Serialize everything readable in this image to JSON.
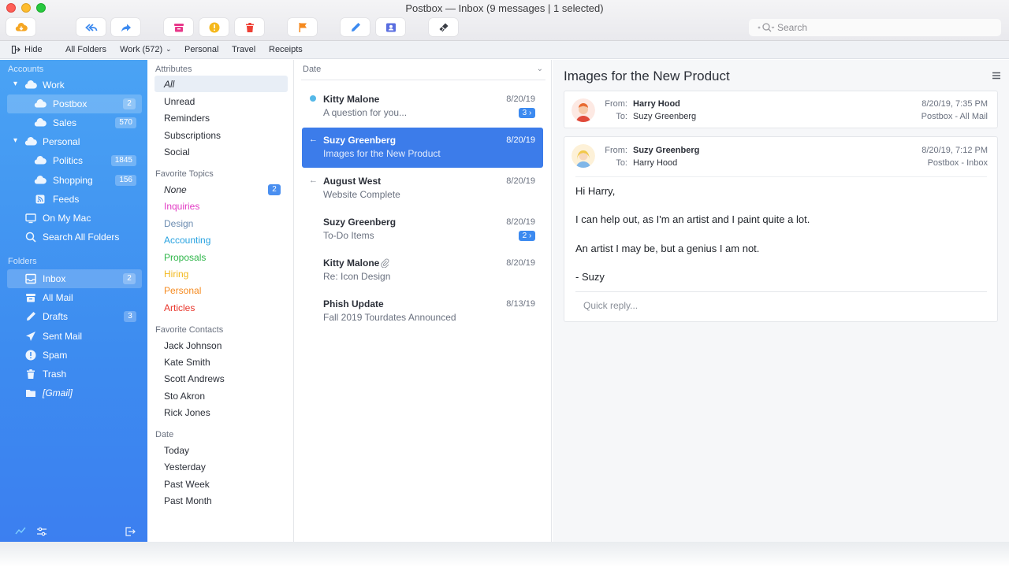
{
  "window": {
    "title": "Postbox — Inbox (9 messages | 1 selected)"
  },
  "toolbar": {
    "buttons": [
      {
        "name": "get-mail-button",
        "icon": "cloud-download-icon"
      },
      {
        "name": "reply-all-button",
        "icon": "reply-all-icon"
      },
      {
        "name": "forward-button",
        "icon": "forward-icon"
      },
      {
        "name": "archive-button",
        "icon": "archive-icon"
      },
      {
        "name": "junk-button",
        "icon": "warning-icon"
      },
      {
        "name": "delete-button",
        "icon": "trash-icon"
      },
      {
        "name": "flag-button",
        "icon": "flag-icon"
      },
      {
        "name": "compose-button",
        "icon": "pencil-icon"
      },
      {
        "name": "contacts-button",
        "icon": "contact-card-icon"
      },
      {
        "name": "customize-button",
        "icon": "brush-icon"
      }
    ],
    "search_placeholder": "Search"
  },
  "tabbar": {
    "hide_label": "Hide",
    "tabs": [
      "All Folders",
      "Work (572)",
      "Personal",
      "Travel",
      "Receipts"
    ]
  },
  "sidebar": {
    "accounts_heading": "Accounts",
    "folders_heading": "Folders",
    "accounts": [
      {
        "label": "Work",
        "badge": ""
      },
      {
        "label": "Postbox",
        "badge": "2"
      },
      {
        "label": "Sales",
        "badge": "570"
      },
      {
        "label": "Personal",
        "badge": ""
      },
      {
        "label": "Politics",
        "badge": "1845"
      },
      {
        "label": "Shopping",
        "badge": "156"
      },
      {
        "label": "Feeds",
        "badge": ""
      },
      {
        "label": "On My Mac",
        "badge": ""
      },
      {
        "label": "Search All Folders",
        "badge": ""
      }
    ],
    "folders": [
      {
        "label": "Inbox",
        "badge": "2"
      },
      {
        "label": "All Mail",
        "badge": ""
      },
      {
        "label": "Drafts",
        "badge": "3"
      },
      {
        "label": "Sent Mail",
        "badge": ""
      },
      {
        "label": "Spam",
        "badge": ""
      },
      {
        "label": "Trash",
        "badge": ""
      },
      {
        "label": "[Gmail]",
        "badge": ""
      }
    ]
  },
  "filters": {
    "attributes_heading": "Attributes",
    "attributes": [
      "All",
      "Unread",
      "Reminders",
      "Subscriptions",
      "Social"
    ],
    "topics_heading": "Favorite Topics",
    "topics": [
      {
        "label": "None",
        "color": "#2b2f38",
        "badge": "2"
      },
      {
        "label": "Inquiries",
        "color": "#e23cc4",
        "badge": ""
      },
      {
        "label": "Design",
        "color": "#6b8bb0",
        "badge": ""
      },
      {
        "label": "Accounting",
        "color": "#27a2e0",
        "badge": ""
      },
      {
        "label": "Proposals",
        "color": "#2fb64a",
        "badge": ""
      },
      {
        "label": "Hiring",
        "color": "#f2b81c",
        "badge": ""
      },
      {
        "label": "Personal",
        "color": "#f58a1f",
        "badge": ""
      },
      {
        "label": "Articles",
        "color": "#e8352b",
        "badge": ""
      }
    ],
    "contacts_heading": "Favorite Contacts",
    "contacts": [
      "Jack Johnson",
      "Kate Smith",
      "Scott Andrews",
      "Sto Akron",
      "Rick Jones"
    ],
    "date_heading": "Date",
    "dates": [
      "Today",
      "Yesterday",
      "Past Week",
      "Past Month"
    ]
  },
  "message_list": {
    "sort_label": "Date",
    "messages": [
      {
        "from": "Kitty Malone",
        "subject": "A question for you...",
        "date": "8/20/19",
        "thread": "3 ›"
      },
      {
        "from": "Suzy Greenberg",
        "subject": "Images for the New Product",
        "date": "8/20/19",
        "thread": ""
      },
      {
        "from": "August West",
        "subject": "Website Complete",
        "date": "8/20/19",
        "thread": ""
      },
      {
        "from": "Suzy Greenberg",
        "subject": "To-Do Items",
        "date": "8/20/19",
        "thread": "2 ›"
      },
      {
        "from": "Kitty Malone",
        "subject": "Re: Icon Design",
        "date": "8/20/19",
        "thread": ""
      },
      {
        "from": "Phish Update",
        "subject": "Fall 2019 Tourdates Announced",
        "date": "8/13/19",
        "thread": ""
      }
    ]
  },
  "reader": {
    "subject": "Images for the New Product",
    "from_label": "From:",
    "to_label": "To:",
    "msg1": {
      "from": "Harry Hood",
      "to": "Suzy Greenberg",
      "date": "8/20/19, 7:35 PM",
      "folder": "Postbox - All Mail"
    },
    "msg2": {
      "from": "Suzy Greenberg",
      "to": "Harry Hood",
      "date": "8/20/19, 7:12 PM",
      "folder": "Postbox - Inbox"
    },
    "body": [
      "Hi Harry,",
      "I can help out, as I'm an artist and I paint quite a lot.",
      "An artist I may be, but a genius I am not.",
      "- Suzy"
    ],
    "quick_reply_placeholder": "Quick reply..."
  },
  "colors": {
    "sidebar": "#4191f2",
    "accent": "#3c7cea"
  }
}
